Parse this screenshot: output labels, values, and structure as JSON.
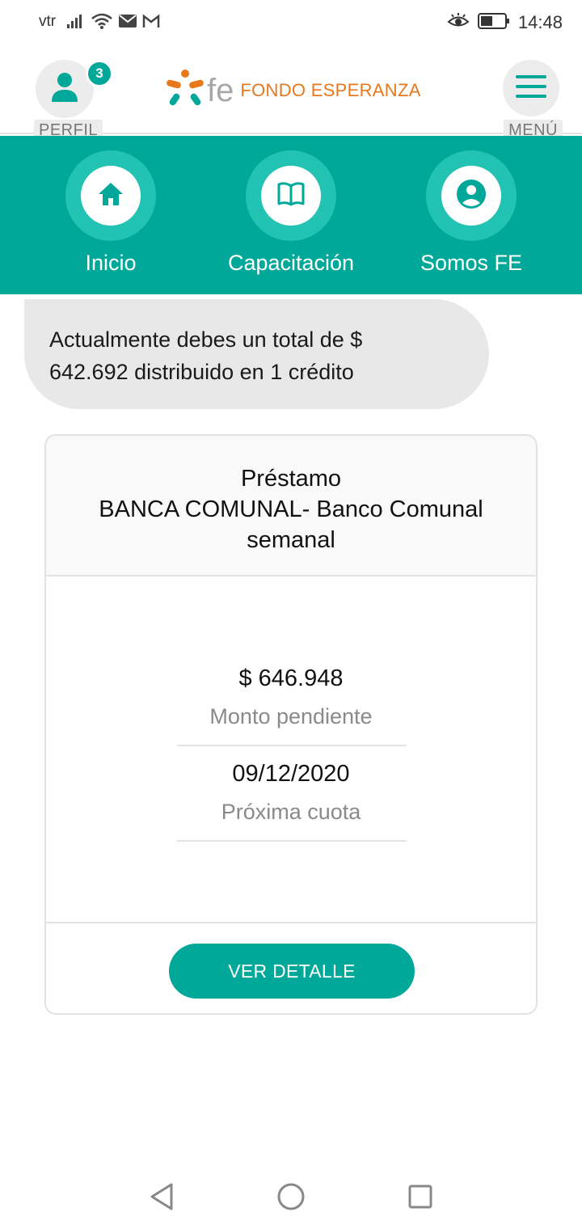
{
  "status_bar": {
    "carrier": "vtr",
    "time": "14:48",
    "icons": [
      "signal-icon",
      "wifi-icon",
      "mail-icon",
      "gmail-icon",
      "eye-comfort-icon",
      "battery-icon"
    ]
  },
  "header": {
    "profile_label": "PERFIL",
    "notification_count": "3",
    "logo_text": "FONDO ESPERANZA",
    "logo_mark": "fe",
    "menu_label": "MENÚ"
  },
  "nav": {
    "items": [
      {
        "label": "Inicio",
        "icon": "home-icon"
      },
      {
        "label": "Capacitación",
        "icon": "book-icon"
      },
      {
        "label": "Somos FE",
        "icon": "user-circle-icon"
      }
    ]
  },
  "summary": {
    "line1": "Actualmente debes un total de $",
    "line2": "642.692 distribuido en 1 crédito"
  },
  "loan_card": {
    "title_line1": "Préstamo",
    "title_line2": "BANCA COMUNAL- Banco Comunal",
    "title_line3": "semanal",
    "amount_value": "$ 646.948",
    "amount_label": "Monto pendiente",
    "next_payment_value": "09/12/2020",
    "next_payment_label": "Próxima cuota",
    "button_label": "VER DETALLE"
  },
  "colors": {
    "accent": "#00a89a",
    "accent_light": "#22c3b3",
    "brand_orange": "#e8781c",
    "bubble_bg": "#e8e8e8"
  }
}
